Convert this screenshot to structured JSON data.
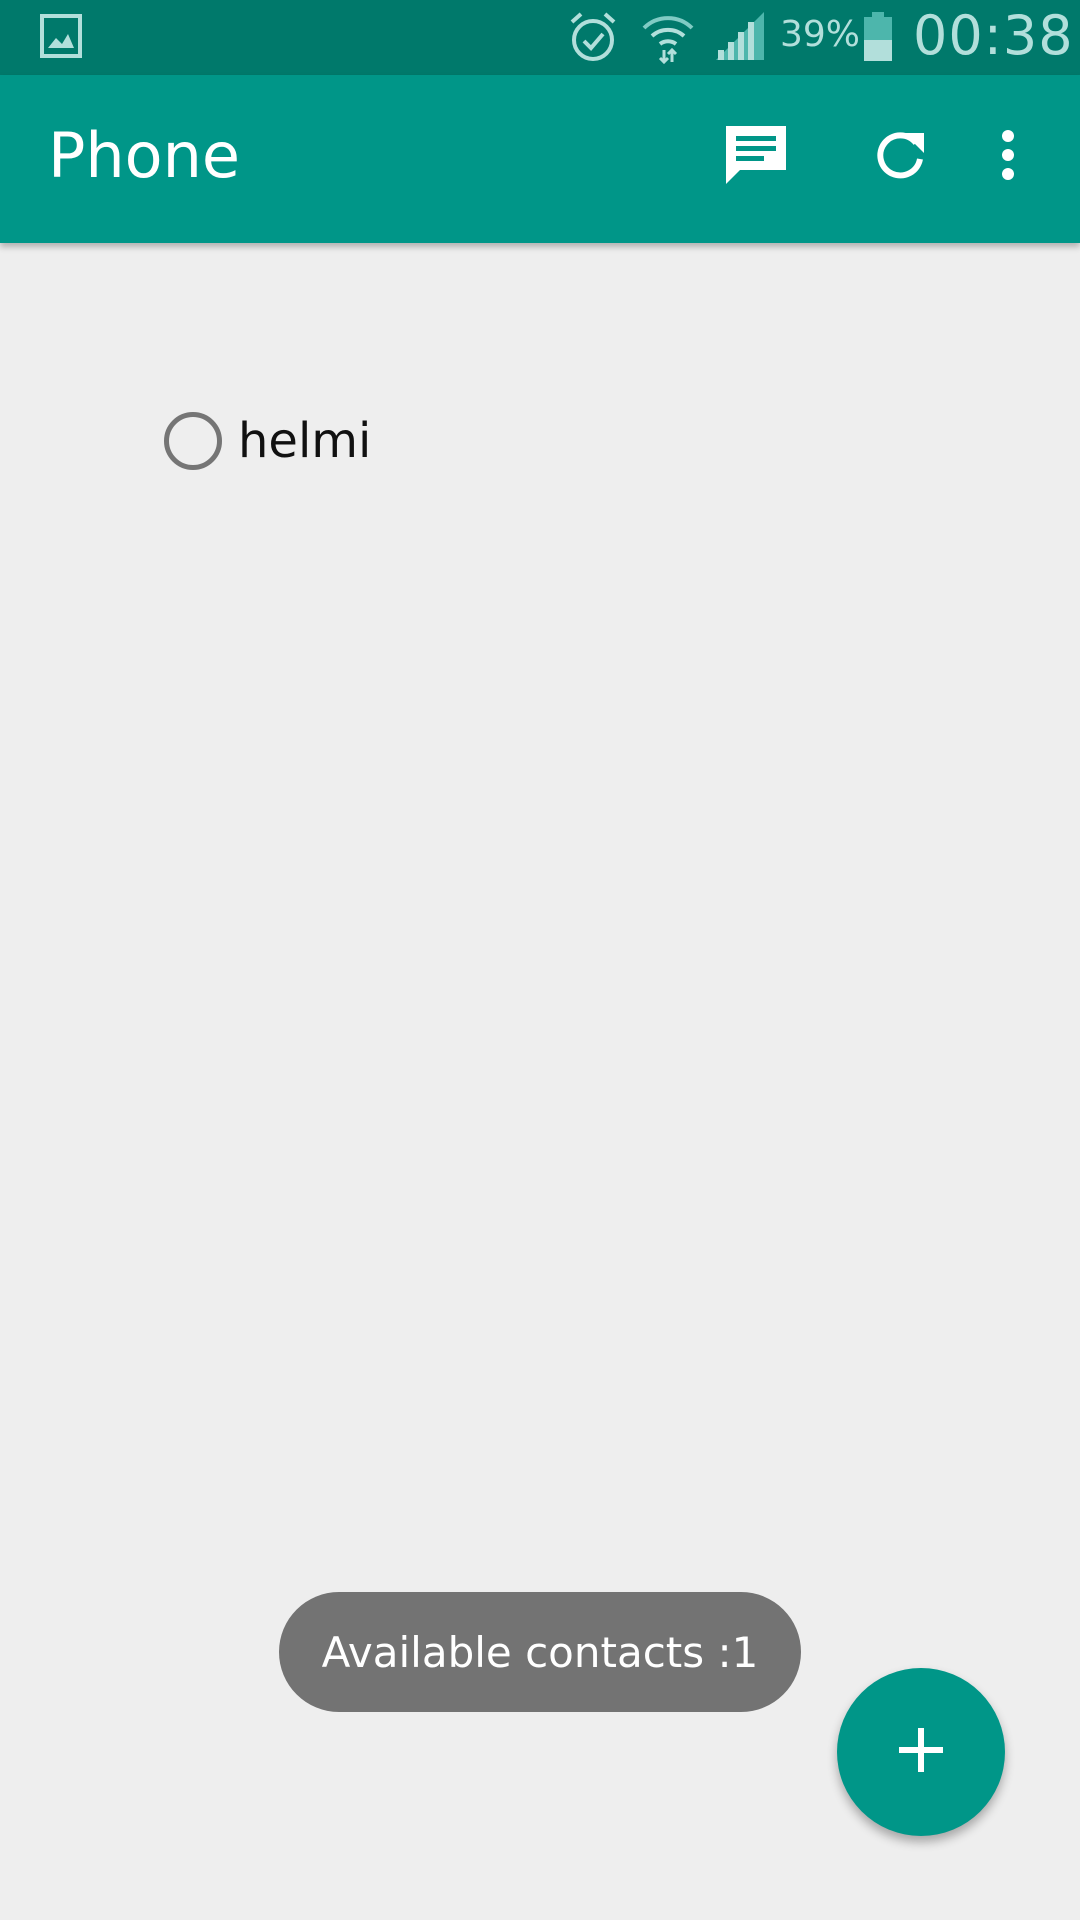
{
  "status_bar": {
    "icons": [
      "gallery-icon",
      "alarm-icon",
      "wifi-icon",
      "signal-icon",
      "battery-icon"
    ],
    "battery_percent": "39%",
    "time": "00:38"
  },
  "app_bar": {
    "title": "Phone",
    "actions": [
      "message-icon",
      "refresh-icon",
      "more-vert-icon"
    ]
  },
  "contacts": [
    {
      "name": "helmi",
      "selected": false
    }
  ],
  "toast": {
    "text": "Available contacts :1"
  },
  "fab": {
    "icon": "add-icon"
  },
  "colors": {
    "primary": "#009688",
    "primary_dark": "#00796b",
    "background": "#eeeeee",
    "toast_bg": "#737373"
  }
}
